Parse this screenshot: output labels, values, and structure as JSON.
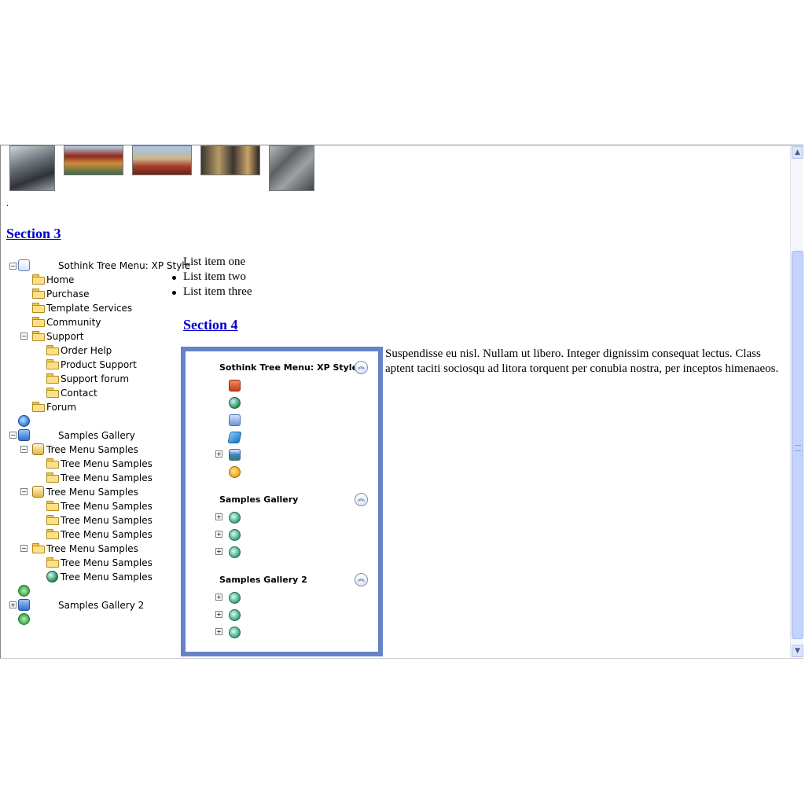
{
  "section3": "Section 3",
  "section4": "Section 4",
  "dot": ".",
  "tree": {
    "root1": "Sothink Tree Menu: XP Style",
    "items1": [
      "Home",
      "Purchase",
      "Template Services",
      "Community",
      "Support"
    ],
    "support_items": [
      "Order Help",
      "Product Support",
      "Support forum",
      "Contact"
    ],
    "forum": "Forum",
    "root2": "Samples Gallery",
    "group_label": "Tree Menu Samples",
    "sample_label": "Tree Menu Samples",
    "root3": "Samples Gallery 2"
  },
  "list": {
    "items": [
      "List item one",
      "List item two",
      "List item three"
    ]
  },
  "xp_panel": {
    "groups": [
      {
        "title": "Sothink Tree Menu: XP Style"
      },
      {
        "title": "Samples Gallery"
      },
      {
        "title": "Samples Gallery 2"
      }
    ]
  },
  "paragraph": "Suspendisse eu nisl. Nullam ut libero. Integer dignissim consequat lectus. Class aptent taciti sociosqu ad litora torquent per conubia nostra, per inceptos himenaeos.",
  "icons": {
    "tree": [
      "document-icon",
      "folder-icon",
      "ie-icon",
      "computer-icon",
      "recycle-icon",
      "globe-icon"
    ],
    "xp": [
      "home-icon",
      "globe-icon",
      "image-icon",
      "disk-icon",
      "photo-folder-icon",
      "smiley-icon",
      "mail-icon"
    ]
  },
  "colors": {
    "panel_border": "#6483c8",
    "link": "#0000cc",
    "folder": "#fbe08a"
  }
}
